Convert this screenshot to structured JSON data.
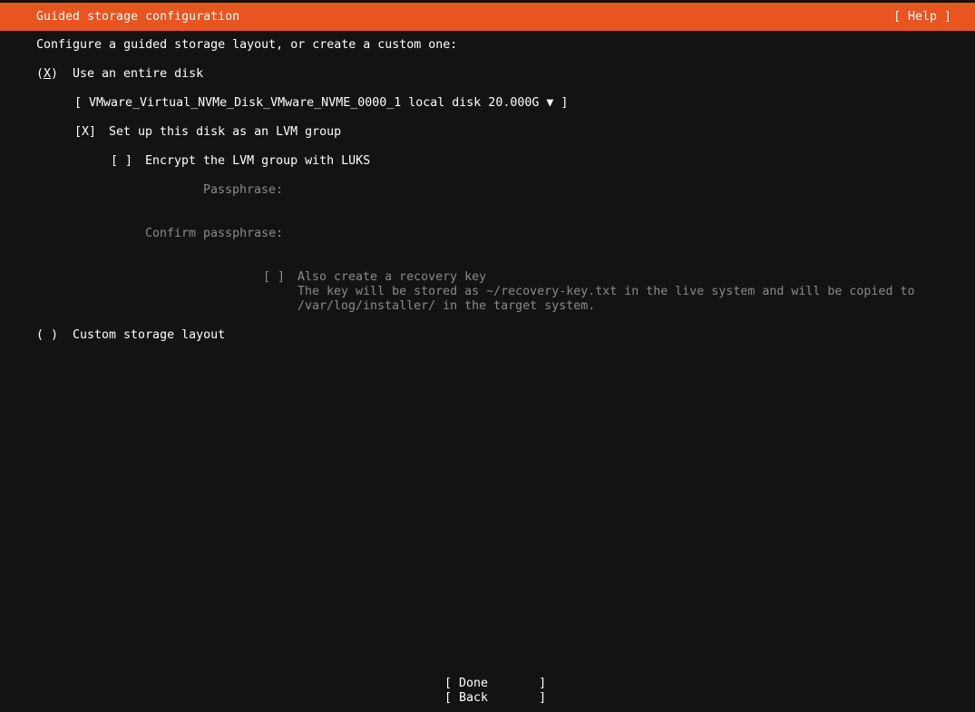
{
  "header": {
    "title": "Guided storage configuration",
    "help": "[ Help ]"
  },
  "intro": "Configure a guided storage layout, or create a custom one:",
  "use_disk": {
    "radio_open": "(",
    "radio_mark": "X",
    "radio_close": ")",
    "label": "Use an entire disk",
    "disk_select": "[ VMware_Virtual_NVMe_Disk_VMware_NVME_0000_1 local disk 20.000G ▼ ]"
  },
  "lvm": {
    "checkbox": "[X]",
    "label": "Set up this disk as an LVM group"
  },
  "encrypt": {
    "checkbox": "[ ]",
    "label": "Encrypt the LVM group with LUKS",
    "passphrase_label": "Passphrase:",
    "confirm_label": "Confirm passphrase:"
  },
  "recovery": {
    "checkbox": "[ ]",
    "label": "Also create a recovery key",
    "desc_line1": "The key will be stored as ~/recovery-key.txt in the live system and will be copied to",
    "desc_line2": "/var/log/installer/ in the target system."
  },
  "custom": {
    "radio": "( )",
    "label": "Custom storage layout"
  },
  "buttons": {
    "done": "[ Done       ]",
    "back": "[ Back       ]"
  },
  "colors": {
    "accent": "#e95420",
    "background": "#131313",
    "text": "#ffffff",
    "disabled": "#8a8a8a"
  }
}
